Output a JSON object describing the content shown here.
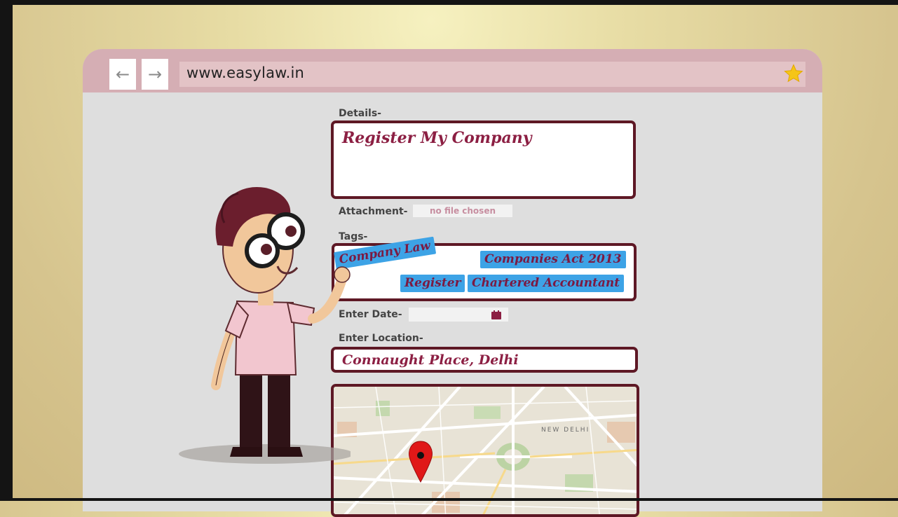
{
  "browser": {
    "back_icon": "arrow-left-icon",
    "forward_icon": "arrow-right-icon",
    "back_glyph": "←",
    "forward_glyph": "→",
    "url": "www.easylaw.in",
    "bookmark_icon": "star-icon"
  },
  "form": {
    "details_label": "Details-",
    "details_value": "Register My Company",
    "attachment_label": "Attachment-",
    "attachment_value": "no file chosen",
    "tags_label": "Tags-",
    "tags": [
      "Company Law",
      "Companies Act 2013",
      "Register",
      "Chartered Accountant"
    ],
    "date_label": "Enter Date-",
    "date_icon": "calendar-icon",
    "location_label": "Enter Location-",
    "location_value": "Connaught Place, Delhi"
  },
  "map": {
    "place_label": "NEW DELHI",
    "marker_icon": "map-pin-icon"
  },
  "colors": {
    "accent": "#5e1825",
    "text_accent": "#8c1f43",
    "tag_bg": "#3da3e6",
    "toolbar": "#d5aeb4",
    "page_bg": "#dedede"
  }
}
